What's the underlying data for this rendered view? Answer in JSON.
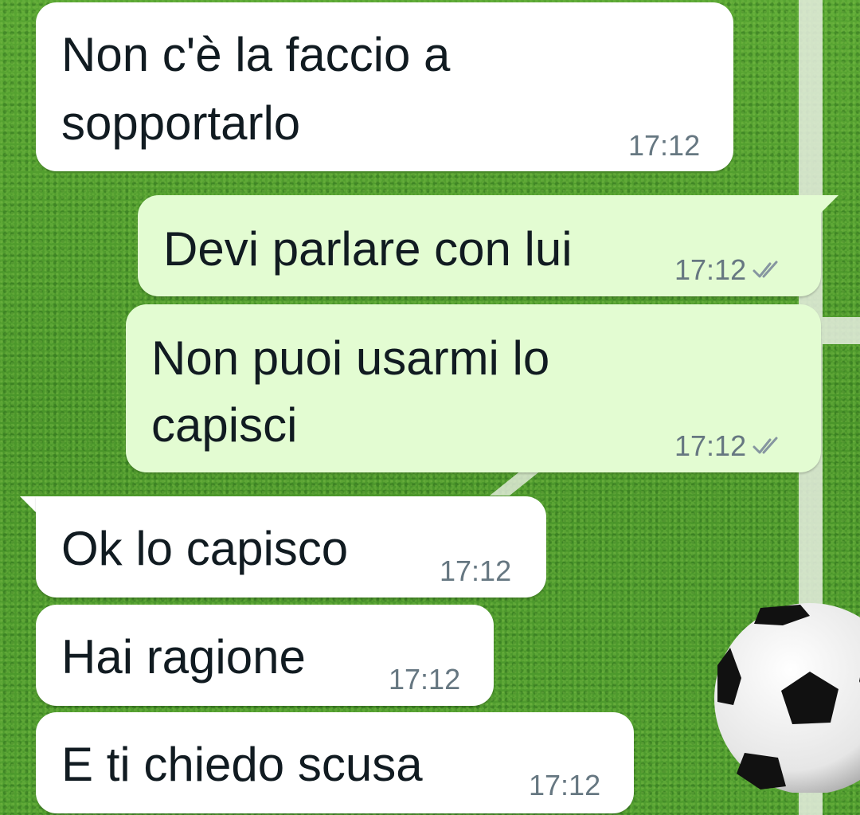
{
  "colors": {
    "incoming_bubble": "#ffffff",
    "outgoing_bubble": "#e3fcd2",
    "text": "#111b21",
    "timestamp": "#667781",
    "wallpaper_grass": "#4f9a2c"
  },
  "wallpaper": {
    "theme": "football-pitch",
    "ball_icon": "soccer-ball-icon"
  },
  "messages": [
    {
      "direction": "incoming",
      "lines": [
        "Non c'è la faccio a",
        "sopportarlo"
      ],
      "time": "17:12"
    },
    {
      "direction": "outgoing",
      "lines": [
        "Devi parlare con lui"
      ],
      "time": "17:12",
      "status_icon": "read-checkmarks-icon"
    },
    {
      "direction": "outgoing",
      "lines": [
        "Non puoi usarmi lo",
        "capisci"
      ],
      "time": "17:12",
      "status_icon": "read-checkmarks-icon"
    },
    {
      "direction": "incoming",
      "lines": [
        "Ok lo capisco"
      ],
      "time": "17:12"
    },
    {
      "direction": "incoming",
      "lines": [
        "Hai ragione"
      ],
      "time": "17:12"
    },
    {
      "direction": "incoming",
      "lines": [
        "E ti chiedo scusa"
      ],
      "time": "17:12"
    }
  ]
}
